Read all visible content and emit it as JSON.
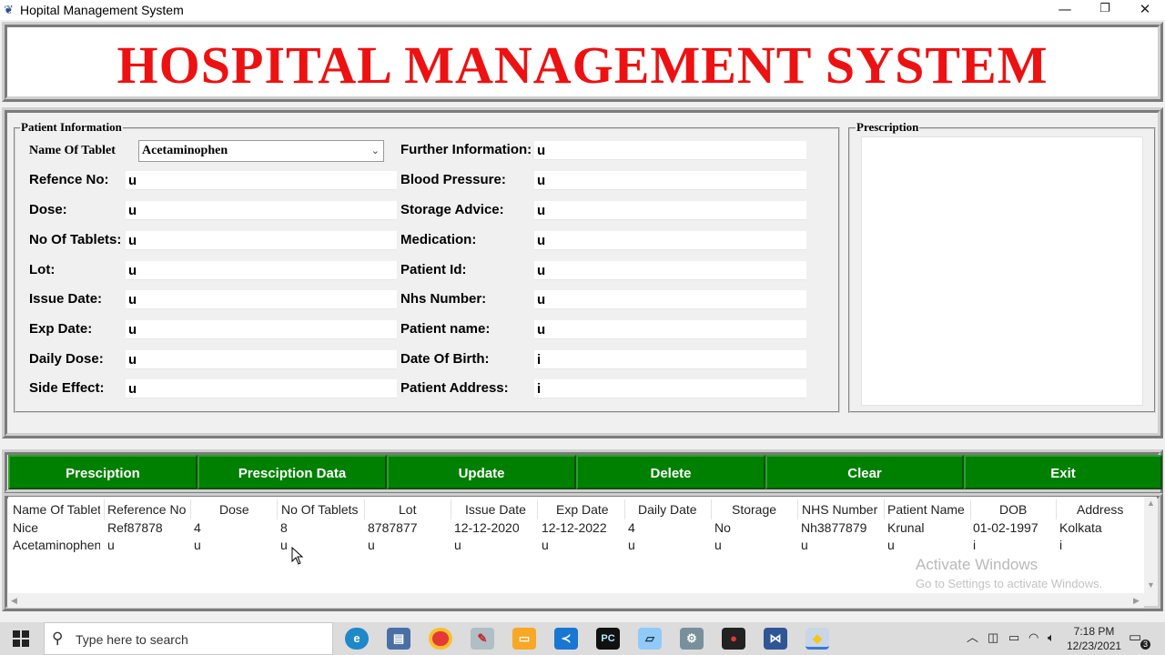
{
  "window": {
    "title": "Hopital Management System",
    "controls": [
      "—",
      "❐",
      "✕"
    ]
  },
  "header": {
    "title": "HOSPITAL MANAGEMENT SYSTEM"
  },
  "patient_info": {
    "frame_label": "Patient Information",
    "tablet_label": "Name Of Tablet",
    "tablet_value": "Acetaminophen",
    "left_fields": [
      {
        "label": "Refence No:",
        "value": "u"
      },
      {
        "label": "Dose:",
        "value": "u"
      },
      {
        "label": "No Of Tablets:",
        "value": "u"
      },
      {
        "label": "Lot:",
        "value": "u"
      },
      {
        "label": "Issue Date:",
        "value": "u"
      },
      {
        "label": "Exp Date:",
        "value": "u"
      },
      {
        "label": "Daily Dose:",
        "value": "u"
      },
      {
        "label": "Side Effect:",
        "value": "u"
      }
    ],
    "right_fields": [
      {
        "label": "Further Information:",
        "value": "u"
      },
      {
        "label": "Blood Pressure:",
        "value": "u"
      },
      {
        "label": "Storage Advice:",
        "value": "u"
      },
      {
        "label": "Medication:",
        "value": "u"
      },
      {
        "label": "Patient Id:",
        "value": "u"
      },
      {
        "label": "Nhs Number:",
        "value": "u"
      },
      {
        "label": "Patient name:",
        "value": "u"
      },
      {
        "label": "Date Of Birth:",
        "value": "i"
      },
      {
        "label": "Patient Address:",
        "value": "i"
      }
    ]
  },
  "prescription": {
    "frame_label": "Prescription",
    "text": ""
  },
  "buttons": {
    "prescription": "Presciption",
    "prescription_data": "Presciption Data",
    "update": "Update",
    "delete": "Delete",
    "clear": "Clear",
    "exit": "Exit"
  },
  "table": {
    "columns": [
      "Name Of Tablet",
      "Reference No",
      "Dose",
      "No Of Tablets",
      "Lot",
      "Issue Date",
      "Exp Date",
      "Daily Date",
      "Storage",
      "NHS Number",
      "Patient Name",
      "DOB",
      "Address"
    ],
    "rows": [
      [
        "Nice",
        "Ref87878",
        "4",
        "8",
        "8787877",
        "12-12-2020",
        "12-12-2022",
        "4",
        "No",
        "Nh3877879",
        "Krunal",
        "01-02-1997",
        "Kolkata"
      ],
      [
        "Acetaminophen",
        "u",
        "u",
        "u",
        "u",
        "u",
        "u",
        "u",
        "u",
        "u",
        "u",
        "i",
        "i"
      ]
    ]
  },
  "watermark": {
    "line1": "Activate Windows",
    "line2": "Go to Settings to activate Windows."
  },
  "taskbar": {
    "search_placeholder": "Type here to search",
    "time": "7:18 PM",
    "date": "12/23/2021",
    "notification_count": "3",
    "icons": [
      "start-icon",
      "edge-icon",
      "task-view-icon",
      "chrome-icon",
      "paint-icon",
      "file-explorer-icon",
      "vscode-icon",
      "pycharm-icon",
      "notepad-icon",
      "settings-icon",
      "media-icon",
      "visual-studio-icon",
      "python-icon"
    ]
  }
}
